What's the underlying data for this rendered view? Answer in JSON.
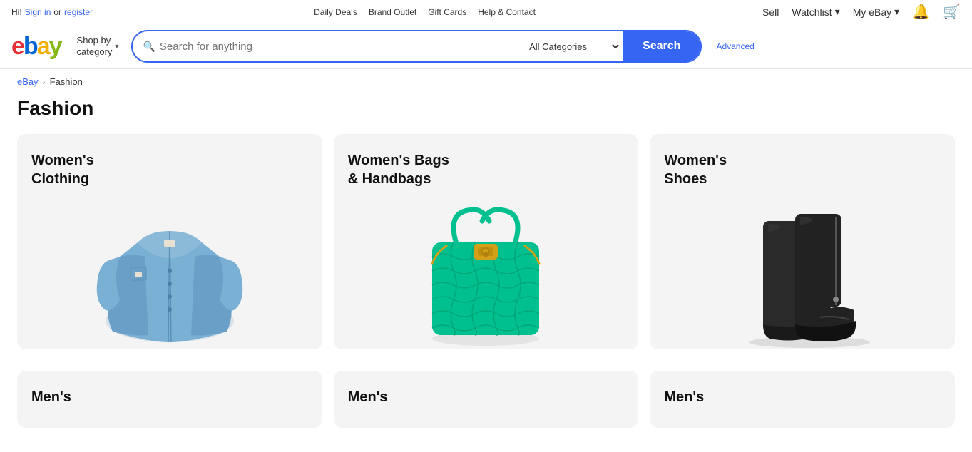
{
  "topbar": {
    "greeting": "Hi! ",
    "signin_label": "Sign in",
    "or_text": " or ",
    "register_label": "register",
    "links": [
      {
        "label": "Daily Deals",
        "name": "daily-deals-link"
      },
      {
        "label": "Brand Outlet",
        "name": "brand-outlet-link"
      },
      {
        "label": "Gift Cards",
        "name": "gift-cards-link"
      },
      {
        "label": "Help & Contact",
        "name": "help-contact-link"
      }
    ],
    "sell_label": "Sell",
    "watchlist_label": "Watchlist",
    "myebay_label": "My eBay",
    "watchlist_dropdown_char": "▾",
    "myebay_dropdown_char": "▾"
  },
  "header": {
    "logo_letters": [
      "e",
      "b",
      "a",
      "y"
    ],
    "shop_by_category": "Shop by\ncategory",
    "search_placeholder": "Search for anything",
    "category_select": "All Categories",
    "search_button": "Search",
    "advanced_label": "Advanced"
  },
  "breadcrumb": {
    "home_label": "eBay",
    "separator": "›",
    "current": "Fashion"
  },
  "page": {
    "title": "Fashion"
  },
  "categories_top": [
    {
      "title": "Women's\nClothing",
      "name": "womens-clothing",
      "image_type": "jacket"
    },
    {
      "title": "Women's Bags\n& Handbags",
      "name": "womens-bags",
      "image_type": "bag"
    },
    {
      "title": "Women's\nShoes",
      "name": "womens-shoes",
      "image_type": "boots"
    }
  ],
  "categories_bottom": [
    {
      "title": "Men's",
      "name": "mens-clothing",
      "image_type": "mens"
    },
    {
      "title": "Men's",
      "name": "mens-bags",
      "image_type": "mens"
    },
    {
      "title": "Men's",
      "name": "mens-shoes",
      "image_type": "mens"
    }
  ],
  "icons": {
    "search": "🔍",
    "chevron_down": "▾",
    "bell": "🔔",
    "cart": "🛒"
  }
}
